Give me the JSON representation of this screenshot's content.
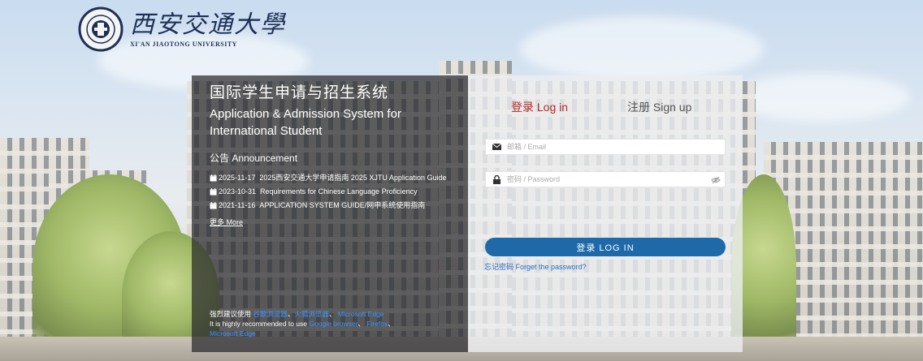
{
  "header": {
    "logo_cn": "西安交通大學",
    "logo_en": "XI'AN JIAOTONG UNIVERSITY"
  },
  "intro": {
    "title_cn": "国际学生申请与招生系统",
    "title_en": "Application & Admission System for International Student"
  },
  "announcements": {
    "heading": "公告 Announcement",
    "items": [
      {
        "date": "2025-11-17",
        "text": "2025西安交通大学申请指南 2025 XJTU Application Guide"
      },
      {
        "date": "2023-10-31",
        "text": "Requirements for Chinese Language Proficiency"
      },
      {
        "date": "2021-11-16",
        "text": "APPLICATION SYSTEM GUIDE/网申系统使用指南"
      }
    ],
    "more": "更多 More"
  },
  "notice": {
    "cn_prefix": "强烈建议使用",
    "cn_browsers": [
      "谷歌浏览器",
      "火狐浏览器",
      "Microsoft Edge"
    ],
    "en_prefix": "It is highly recommended to use",
    "en_browsers": [
      "Google browser",
      "Firefox",
      "Microsoft Edge"
    ],
    "sep": "、"
  },
  "login": {
    "tab_login": "登录 Log in",
    "tab_signup": "注册 Sign up",
    "email_placeholder": "邮箱 / Email",
    "password_placeholder": "密码 / Password",
    "button": "登录 LOG IN",
    "forgot": "忘记密码 Forget the password?"
  },
  "colors": {
    "accent": "#1f69a9",
    "tab_active": "#b72a2a",
    "link": "#3b95ff"
  }
}
